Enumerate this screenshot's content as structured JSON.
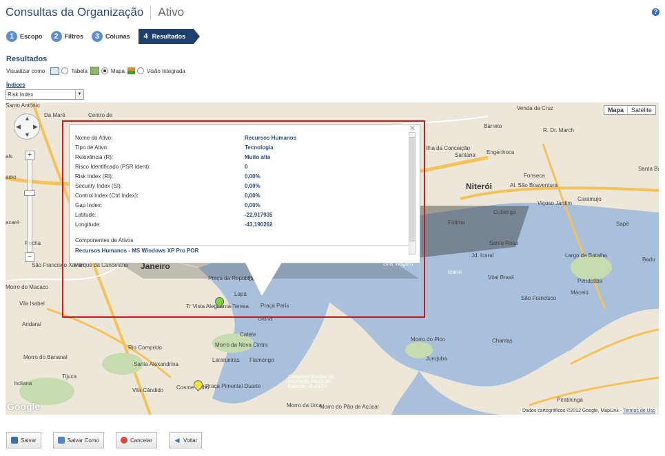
{
  "header": {
    "title": "Consultas da Organização",
    "subtitle": "Ativo",
    "help_icon": "help-icon"
  },
  "steps": [
    {
      "num": "1",
      "label": "Escopo"
    },
    {
      "num": "2",
      "label": "Filtros"
    },
    {
      "num": "3",
      "label": "Colunas"
    },
    {
      "num": "4",
      "label": "Resultados"
    }
  ],
  "results": {
    "title": "Resultados",
    "view_as": "Visualizar como",
    "options": [
      "Tabela",
      "Mapa",
      "Visão Integrada"
    ],
    "selected": "Mapa"
  },
  "indices": {
    "label": "Índices",
    "value": "Risk Index"
  },
  "map": {
    "type_map": "Mapa",
    "type_satellite": "Satélite",
    "google": "Google",
    "copyright": "Dados cartográficos ©2012 Google, MapLink - ",
    "terms": "Termos de Uso",
    "labels": {
      "santo_antonio": "Santo Antônio",
      "da_mare": "Da Maré",
      "centro_de": "Centro de",
      "venda_da_cruz": "Venda da Cruz",
      "barreto": "Barreto",
      "r_dr_march": "R. Dr. March",
      "ilha_da_conceicao": "Ilha da Conceição",
      "santana": "Santana",
      "engenhoca": "Engenhoca",
      "fonseca": "Fonseca",
      "santa_barbara": "Santa Bárbara",
      "niteroi": "Niterói",
      "al_sao_boaventura": "Al. São Boaventura",
      "caramujo": "Caramujo",
      "cubango": "Cubango",
      "vicoso_jardim": "Viçoso Jardim",
      "fatima": "Fátima",
      "sape": "Sapê",
      "santa_rosa": "Santa Rosa",
      "largo_da_batalha": "Largo da Batalha",
      "badu": "Badu",
      "jd_icarai": "Jd. Icaraí",
      "boa_viagem": "Boa Viagem",
      "icarai": "Icaraí",
      "vital_brasil": "Vital Brasil",
      "pendotiba": "Pendotiba",
      "sao_francisco": "São Francisco",
      "maceio": "Maceió",
      "janeiro": "Janeiro",
      "sao_francisco_xavier": "São Francisco Xavier",
      "morro_do_macaco": "Morro do Macaco",
      "vila_isabel": "Vila Isabel",
      "parque_da_candelaria": "Parque da Candelária",
      "praca_da_republica": "Praça da República",
      "centro": "Centro",
      "lapa": "Lapa",
      "tr_vista_alegre": "Tr Vista Alegre",
      "santa_teresa": "Santa Teresa",
      "praca_paris": "Praça Paris",
      "gloria": "Glória",
      "andarai": "Andaraí",
      "catete": "Catete",
      "morro_da_nova_cintra": "Morro da Nova Cintra",
      "laranjeiras": "Laranjeiras",
      "flamengo": "Flamengo",
      "rio_comprido": "Rio Comprido",
      "morro_do_banana": "Morro do Bananal",
      "santa_alexandrina": "Santa Alexandrina",
      "tijuca": "Tijuca",
      "indiana": "Indiana",
      "vila_candido": "Vila Cândido",
      "cosme_velho": "Cosme Velho",
      "praca_pimentel_duarte": "Praça Pimentel Duarte",
      "complexo": "Complexo Escolar de Educação Física do Exército - EsEFEx",
      "morro_do_pico": "Morro do Pico",
      "jurujuba": "Jurujuba",
      "chantas": "Chantas",
      "piratininga": "Piratininga",
      "morro_da_urca": "Morro da Urca",
      "morro_do_pao": "Morro do Pão de Açúcar",
      "rocha": "Rocha",
      "acare": "acaré",
      "amo": "amo",
      "ais": "ais"
    }
  },
  "popup": {
    "rows": [
      {
        "k": "Nome do Ativo:",
        "v": "Recursos Humanos"
      },
      {
        "k": "Tipo de Ativo:",
        "v": "Tecnologia"
      },
      {
        "k": "Relevância (R):",
        "v": "Muito alta"
      },
      {
        "k": "Risco Identificado (PSR Ident):",
        "v": "0"
      },
      {
        "k": "Risk Index (RI):",
        "v": "0,00%"
      },
      {
        "k": "Security Index (SI):",
        "v": "0,00%"
      },
      {
        "k": "Control Index (Ctrl Index):",
        "v": "0,00%"
      },
      {
        "k": "Gap Index:",
        "v": "0,00%"
      },
      {
        "k": "Latitude:",
        "v": "-22,917935"
      },
      {
        "k": "Longitude:",
        "v": "-43,190262"
      }
    ],
    "components_title": "Componentes de Ativos",
    "component": "Recursos Humanos - MS Windows XP Pro POR"
  },
  "buttons": {
    "save": "Salvar",
    "save_as": "Salvar Como",
    "cancel": "Cancelar",
    "back": "Voltar"
  }
}
